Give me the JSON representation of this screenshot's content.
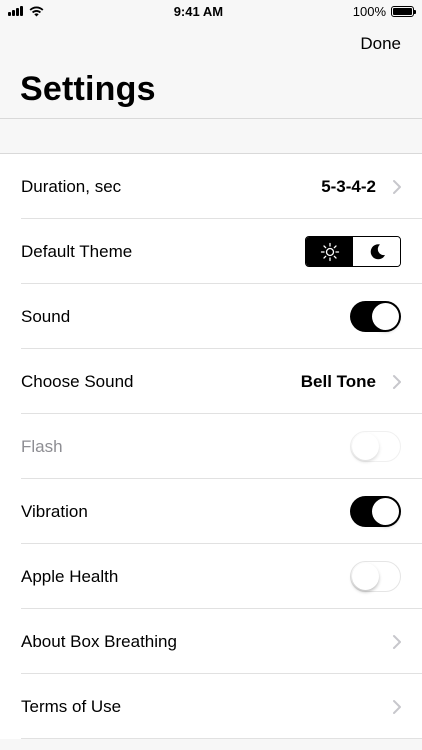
{
  "status_bar": {
    "time": "9:41 AM",
    "battery_text": "100%",
    "icons": [
      "cellular-signal-icon",
      "wifi-icon",
      "battery-icon"
    ]
  },
  "nav": {
    "done_label": "Done",
    "title": "Settings"
  },
  "settings": {
    "duration": {
      "label": "Duration, sec",
      "value": "5-3-4-2"
    },
    "theme": {
      "label": "Default Theme",
      "options": [
        "sun-icon",
        "moon-icon"
      ],
      "selected": "light"
    },
    "sound": {
      "label": "Sound",
      "on": true
    },
    "choose_sound": {
      "label": "Choose Sound",
      "value": "Bell Tone"
    },
    "flash": {
      "label": "Flash",
      "on": false,
      "disabled": true
    },
    "vibration": {
      "label": "Vibration",
      "on": true
    },
    "apple_health": {
      "label": "Apple Health",
      "on": false
    },
    "about": {
      "label": "About Box Breathing"
    },
    "terms": {
      "label": "Terms of Use"
    }
  },
  "colors": {
    "accent": "#000000",
    "background": "#f7f7f7",
    "separator": "#e1e1e1",
    "disabled_text": "#8e8e93"
  }
}
